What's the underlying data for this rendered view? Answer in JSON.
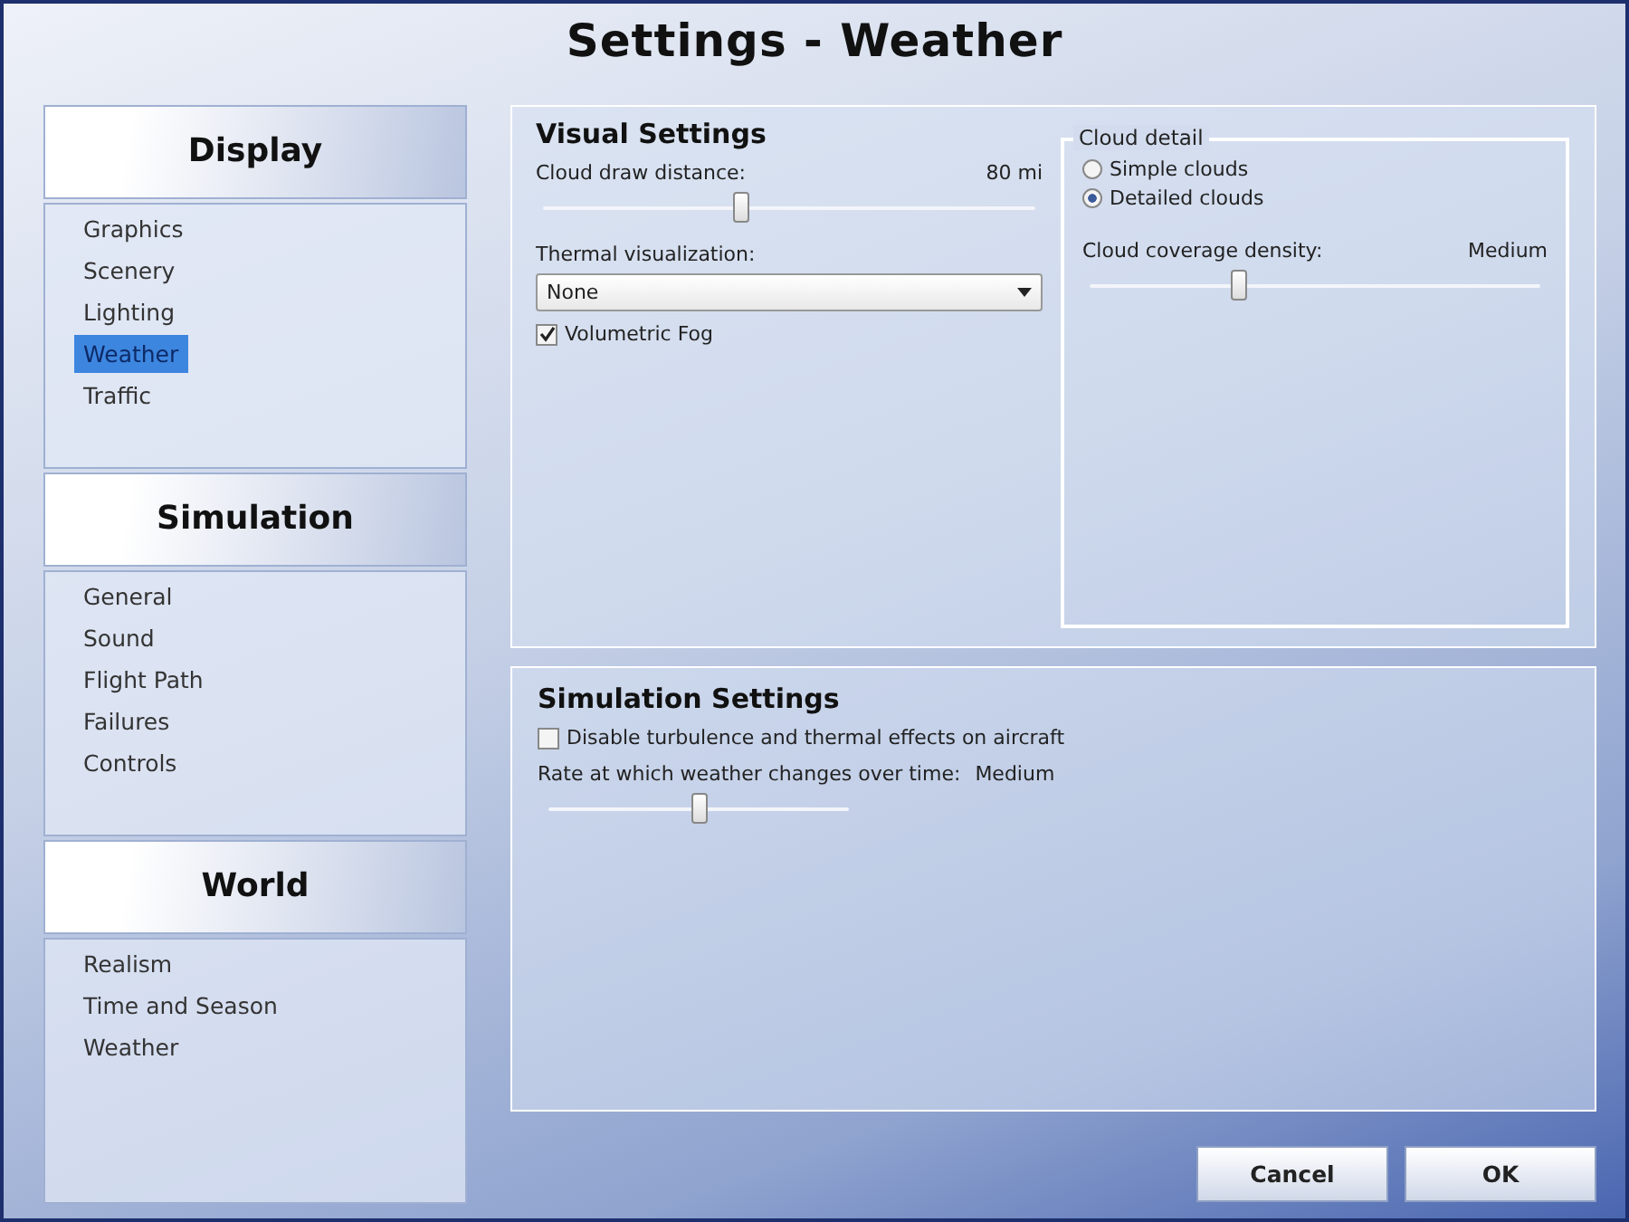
{
  "window": {
    "title": "Settings - Weather"
  },
  "sidebar": {
    "sections": [
      {
        "heading": "Display",
        "items": [
          {
            "label": "Graphics",
            "selected": false
          },
          {
            "label": "Scenery",
            "selected": false
          },
          {
            "label": "Lighting",
            "selected": false
          },
          {
            "label": "Weather",
            "selected": true
          },
          {
            "label": "Traffic",
            "selected": false
          }
        ]
      },
      {
        "heading": "Simulation",
        "items": [
          {
            "label": "General",
            "selected": false
          },
          {
            "label": "Sound",
            "selected": false
          },
          {
            "label": "Flight Path",
            "selected": false
          },
          {
            "label": "Failures",
            "selected": false
          },
          {
            "label": "Controls",
            "selected": false
          }
        ]
      },
      {
        "heading": "World",
        "items": [
          {
            "label": "Realism",
            "selected": false
          },
          {
            "label": "Time and Season",
            "selected": false
          },
          {
            "label": "Weather",
            "selected": false
          }
        ]
      }
    ]
  },
  "visual_settings": {
    "title": "Visual Settings",
    "cloud_draw_distance": {
      "label": "Cloud draw distance:",
      "reading": "80 mi",
      "level": 0.4
    },
    "thermal_visualization": {
      "label": "Thermal visualization:",
      "value": "None"
    },
    "volumetric_fog": {
      "label": "Volumetric Fog",
      "checked": true
    },
    "cloud_detail": {
      "title": "Cloud detail",
      "options": [
        {
          "label": "Simple clouds",
          "selected": false
        },
        {
          "label": "Detailed clouds",
          "selected": true
        }
      ],
      "coverage": {
        "label": "Cloud coverage density:",
        "reading": "Medium",
        "level": 0.33
      }
    }
  },
  "simulation_settings": {
    "title": "Simulation Settings",
    "disable_turbulence": {
      "label": "Disable turbulence and thermal effects on aircraft",
      "checked": false
    },
    "weather_rate": {
      "label": "Rate at which weather changes over time:",
      "reading": "Medium",
      "level": 0.5
    }
  },
  "buttons": [
    {
      "label": "Cancel"
    },
    {
      "label": "OK"
    }
  ]
}
